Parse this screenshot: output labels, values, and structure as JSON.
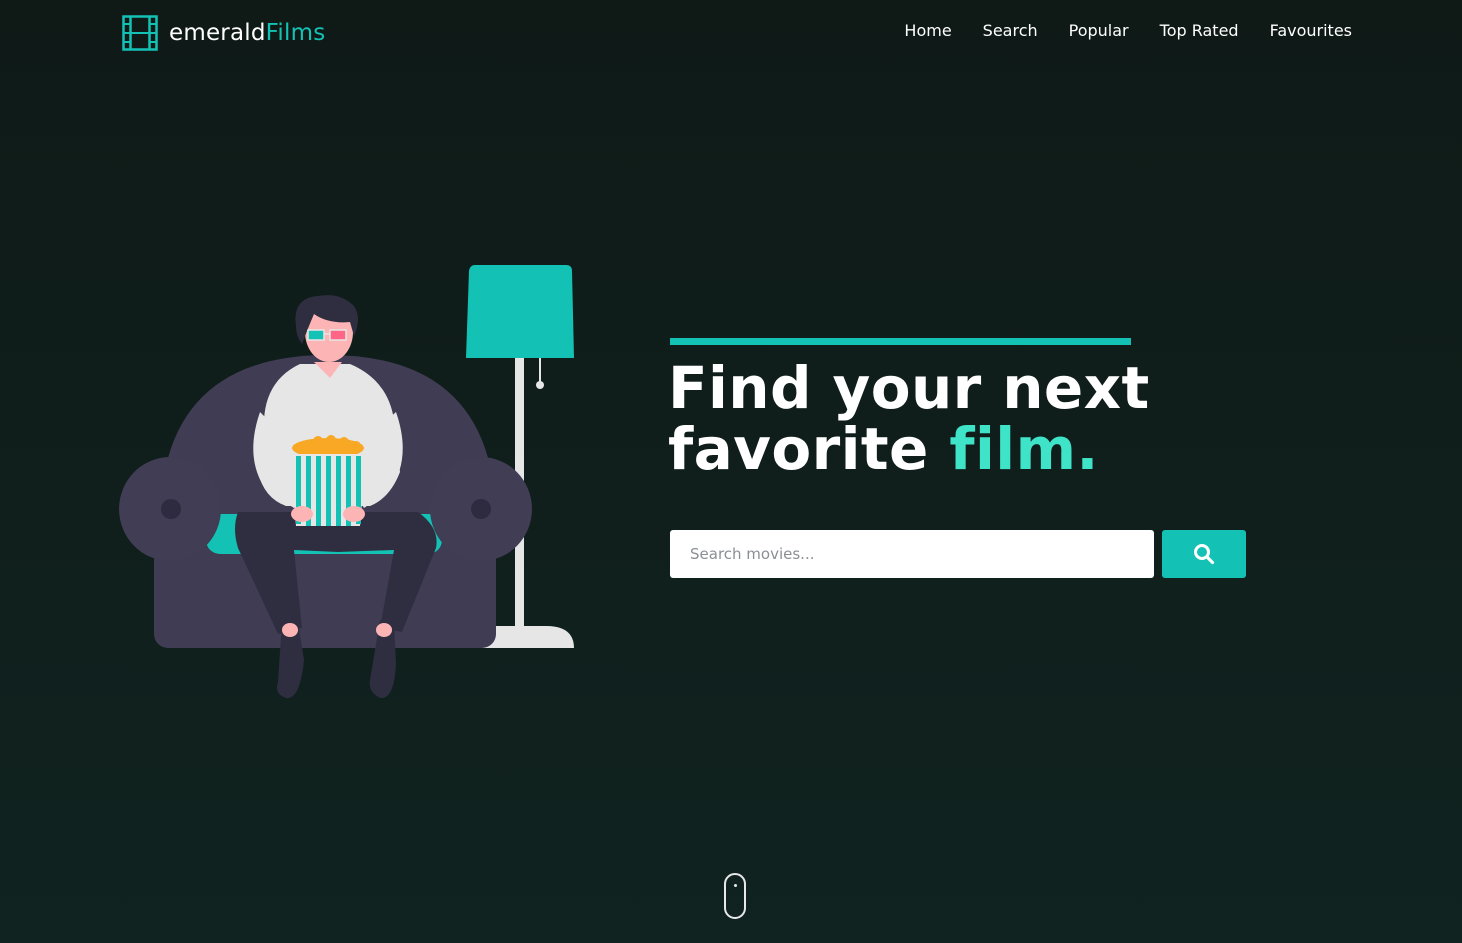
{
  "brand": {
    "name_part1": "emerald",
    "name_part2": "Films",
    "icon": "film-strip-icon"
  },
  "nav": {
    "items": [
      {
        "label": "Home"
      },
      {
        "label": "Search"
      },
      {
        "label": "Popular"
      },
      {
        "label": "Top Rated"
      },
      {
        "label": "Favourites"
      }
    ]
  },
  "hero": {
    "title_line1": "Find your next",
    "title_line2_plain": "favorite ",
    "title_line2_accent": "film."
  },
  "search": {
    "placeholder": "Search movies...",
    "value": "",
    "button_icon": "search-icon"
  },
  "scroll": {
    "icon": "mouse-scroll-icon"
  },
  "colors": {
    "background": "#0f1f1c",
    "accent": "#14c2b5",
    "accent_light": "#3fe3c8",
    "text": "#ffffff"
  }
}
